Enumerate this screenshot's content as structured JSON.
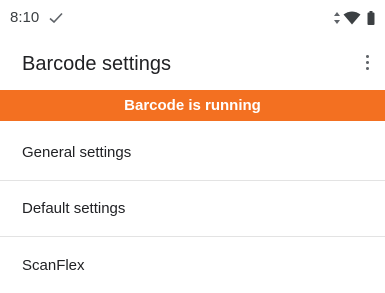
{
  "status_bar": {
    "time": "8:10",
    "icons": [
      "check-icon",
      "data-arrows-icon",
      "wifi-icon",
      "battery-icon"
    ]
  },
  "app_bar": {
    "title": "Barcode settings",
    "overflow_icon": "more-vert-icon"
  },
  "banner": {
    "text": "Barcode is running",
    "color": "#f37021"
  },
  "settings": {
    "items": [
      {
        "label": "General settings"
      },
      {
        "label": "Default settings"
      },
      {
        "label": "ScanFlex"
      }
    ]
  }
}
